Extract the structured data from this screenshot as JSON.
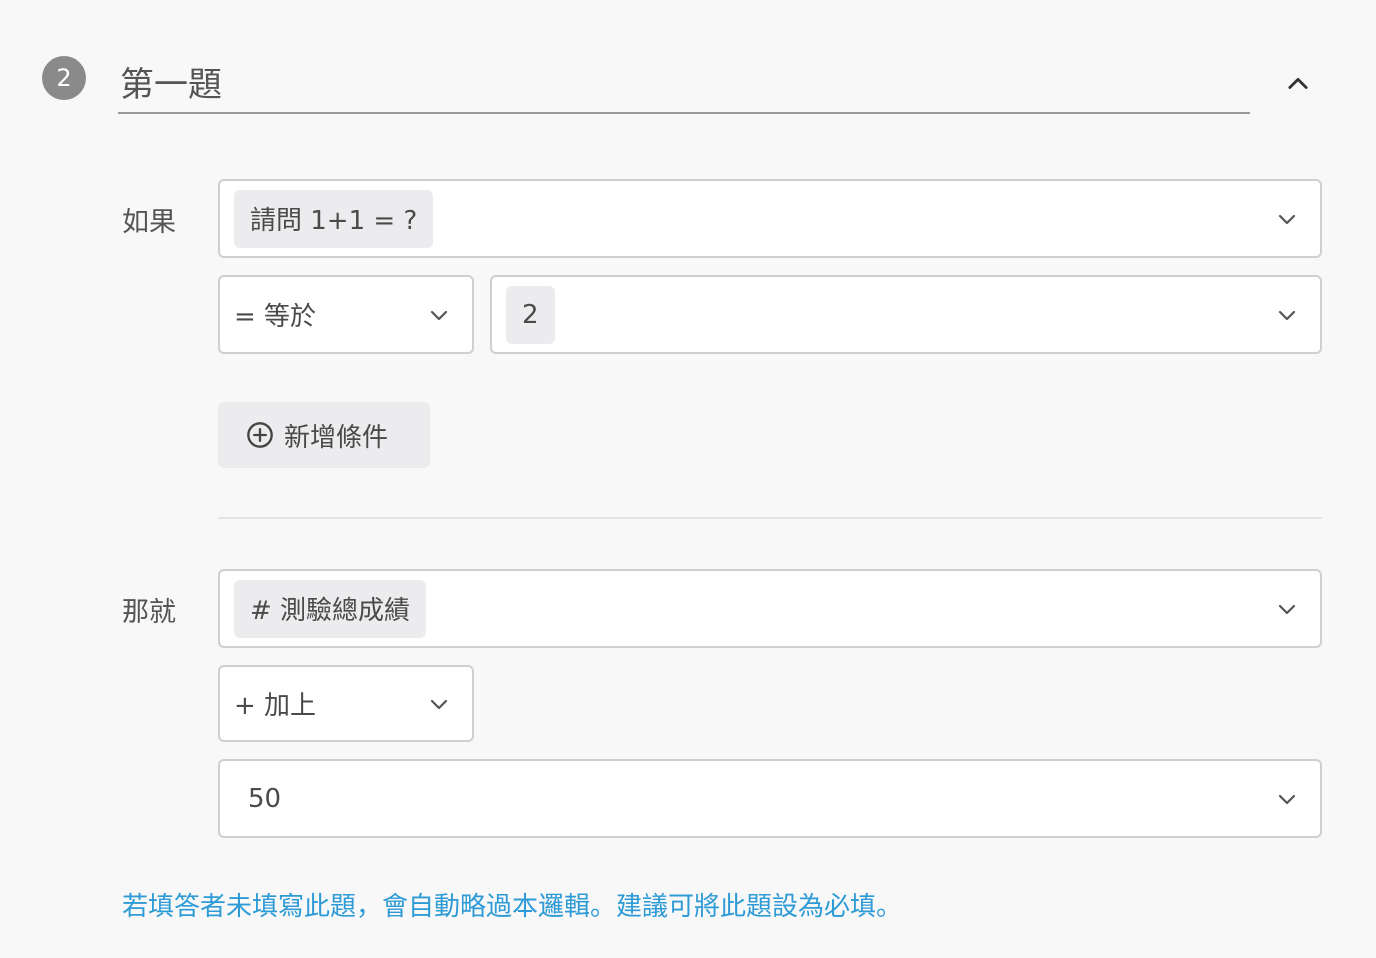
{
  "header": {
    "step_number": "2",
    "title": "第一題"
  },
  "condition": {
    "label": "如果",
    "question": "請問 1+1 = ?",
    "operator": "= 等於",
    "value": "2",
    "add_condition_label": "新增條件"
  },
  "action": {
    "label": "那就",
    "target": "# 測驗總成績",
    "operation": "+ 加上",
    "amount": "50"
  },
  "hint_text": "若填答者未填寫此題，會自動略過本邏輯。建議可將此題設為必填。",
  "colors": {
    "hint": "#2f9bd6",
    "badge": "#8a8a8a"
  }
}
